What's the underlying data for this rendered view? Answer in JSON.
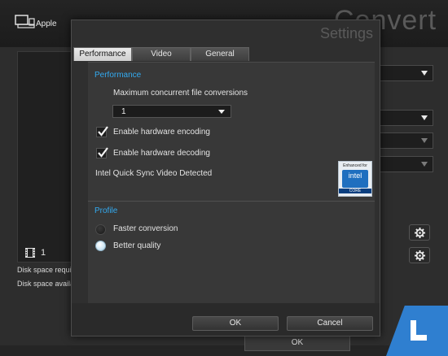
{
  "app": {
    "device_label": "Apple",
    "title": "Convert",
    "file_count": "1",
    "disk_required_label": "Disk space require",
    "disk_available_label": "Disk space availa",
    "ok_label": "OK"
  },
  "dialog": {
    "title": "Settings",
    "tabs": [
      {
        "label": "Performance",
        "active": true
      },
      {
        "label": "Video",
        "active": false
      },
      {
        "label": "General",
        "active": false
      }
    ],
    "performance": {
      "section_title": "Performance",
      "max_conversions_label": "Maximum concurrent file conversions",
      "max_conversions_value": "1",
      "hw_encoding_label": "Enable hardware encoding",
      "hw_encoding_checked": true,
      "hw_decoding_label": "Enable hardware decoding",
      "hw_decoding_checked": true,
      "quick_sync_label": "Intel Quick Sync Video Detected",
      "badge": {
        "top": "Enhanced for",
        "logo": "intel",
        "bottom": "CORE"
      }
    },
    "profile": {
      "section_title": "Profile",
      "options": [
        {
          "label": "Faster conversion",
          "selected": false
        },
        {
          "label": "Better quality",
          "selected": true
        }
      ]
    },
    "buttons": {
      "ok": "OK",
      "cancel": "Cancel"
    }
  },
  "colors": {
    "accent": "#33aaf0",
    "background": "#2b2b2b",
    "dialog": "#2f2f2f",
    "panel": "#383838",
    "logo_blue": "#2f7fd0"
  }
}
